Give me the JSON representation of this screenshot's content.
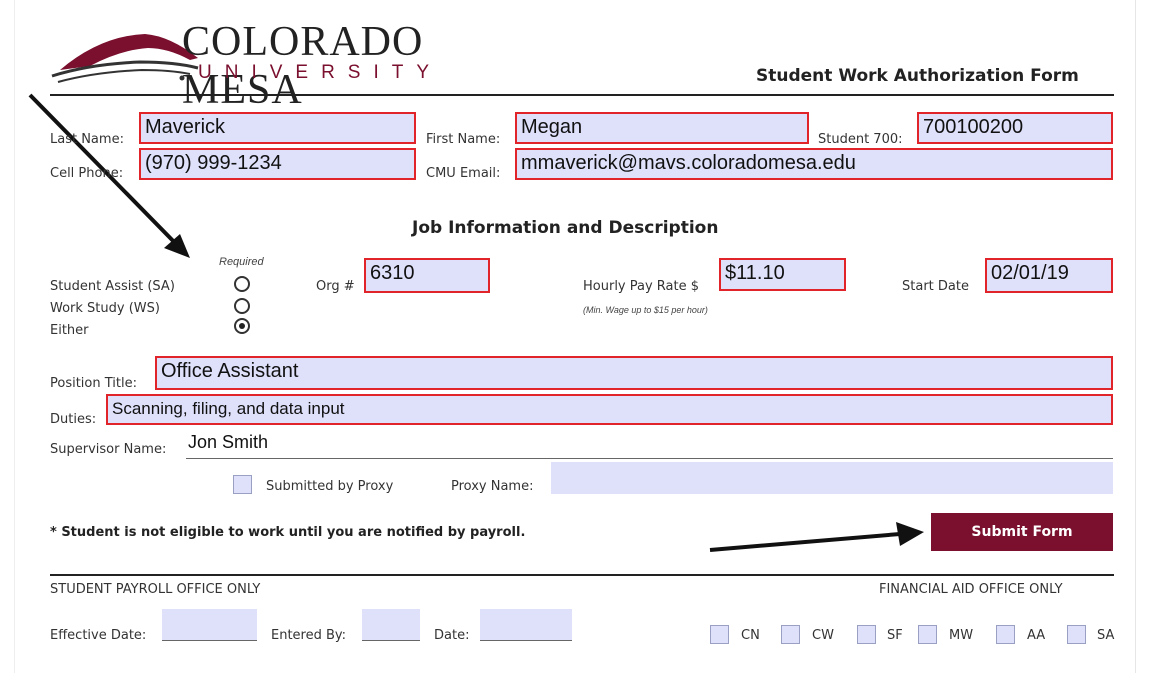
{
  "header": {
    "logo_main": "COLORADO MESA",
    "logo_sub": "UNIVERSITY",
    "form_title": "Student Work Authorization Form"
  },
  "student": {
    "last_name_label": "Last Name:",
    "last_name_value": "Maverick",
    "first_name_label": "First Name:",
    "first_name_value": "Megan",
    "student700_label": "Student 700:",
    "student700_value": "700100200",
    "cell_label": "Cell Phone:",
    "cell_value": "(970) 999-1234",
    "email_label": "CMU Email:",
    "email_value": "mmaverick@mavs.coloradomesa.edu"
  },
  "job": {
    "section_title": "Job Information and Description",
    "required_label": "Required",
    "options": [
      "Student Assist (SA)",
      "Work Study (WS)",
      "Either"
    ],
    "selected_option": "Either",
    "org_label": "Org #",
    "org_value": "6310",
    "pay_label": "Hourly Pay Rate $",
    "pay_value": "$11.10",
    "pay_note": "(Min. Wage up to $15 per hour)",
    "start_label": "Start Date",
    "start_value": "02/01/19",
    "position_label": "Position Title:",
    "position_value": "Office Assistant",
    "duties_label": "Duties:",
    "duties_value": "Scanning, filing, and data input",
    "supervisor_label": "Supervisor Name:",
    "supervisor_value": "Jon Smith",
    "proxy_checkbox_label": "Submitted by Proxy",
    "proxy_name_label": "Proxy Name:",
    "proxy_name_value": ""
  },
  "notice": "* Student is not eligible to work until you are notified by payroll.",
  "submit_label": "Submit Form",
  "payroll": {
    "title": "STUDENT PAYROLL OFFICE ONLY",
    "effective_label": "Effective Date:",
    "entered_label": "Entered By:",
    "date_label": "Date:"
  },
  "finaid": {
    "title": "FINANCIAL AID OFFICE ONLY",
    "codes": [
      "CN",
      "CW",
      "SF",
      "MW",
      "AA",
      "SA"
    ]
  },
  "colors": {
    "brand_maroon": "#7a0f2e",
    "field_fill": "#dfe1fb",
    "field_border": "#e0242a"
  }
}
